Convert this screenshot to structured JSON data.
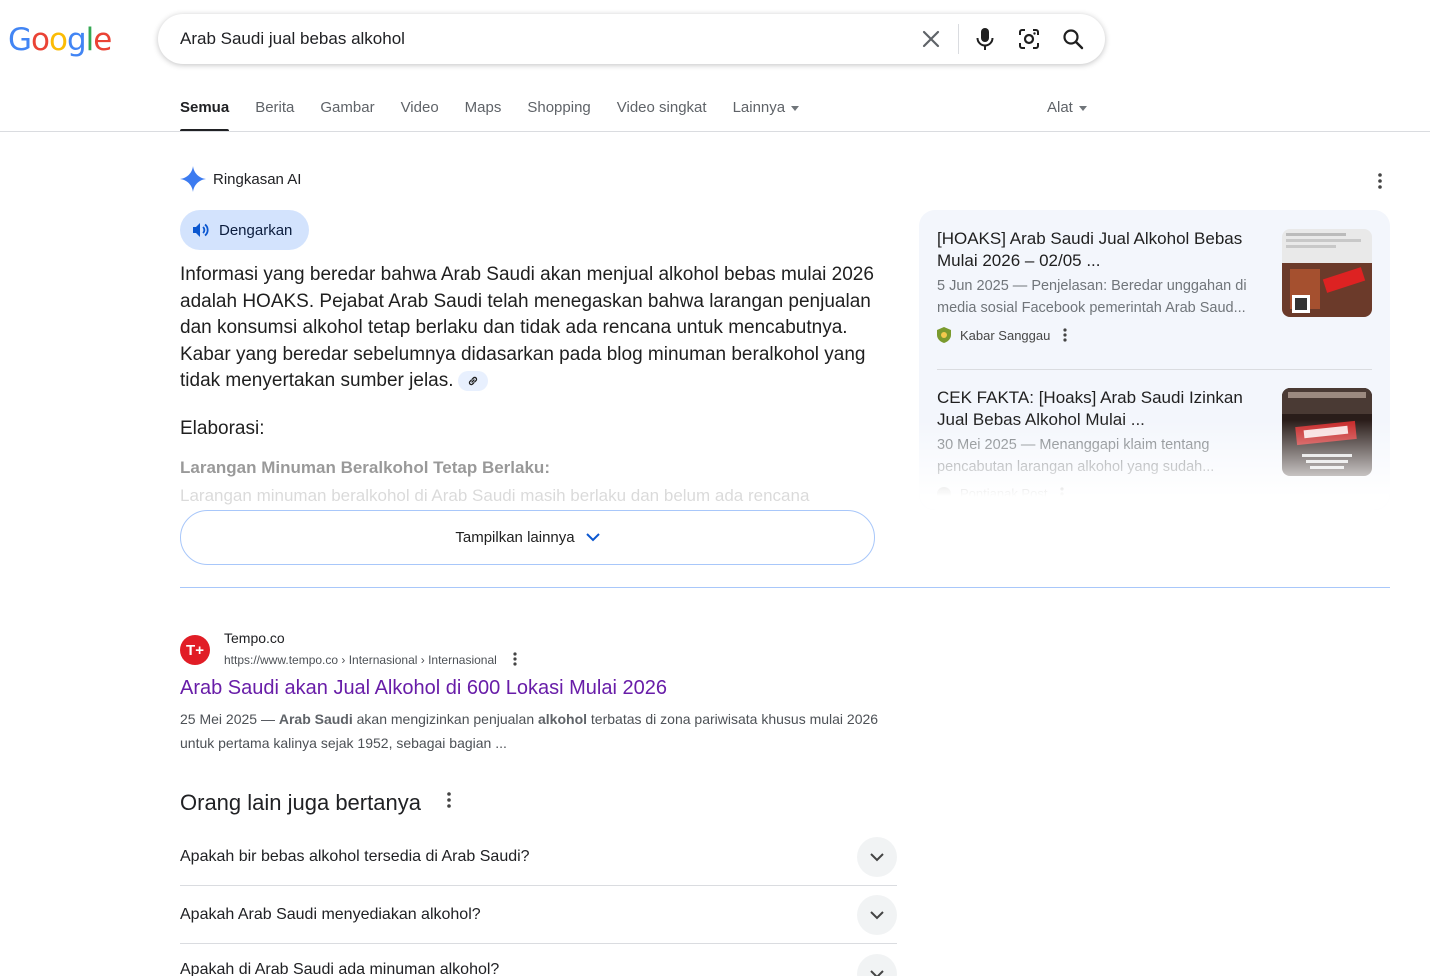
{
  "search": {
    "query": "Arab Saudi jual bebas alkohol"
  },
  "tabs": [
    {
      "label": "Semua"
    },
    {
      "label": "Berita"
    },
    {
      "label": "Gambar"
    },
    {
      "label": "Video"
    },
    {
      "label": "Maps"
    },
    {
      "label": "Shopping"
    },
    {
      "label": "Video singkat"
    },
    {
      "label": "Lainnya"
    }
  ],
  "tools_label": "Alat",
  "ai": {
    "title": "Ringkasan AI",
    "listen_label": "Dengarkan",
    "text": "Informasi yang beredar bahwa Arab Saudi akan menjual alkohol bebas mulai 2026 adalah HOAKS. Pejabat Arab Saudi telah menegaskan bahwa larangan penjualan dan konsumsi alkohol tetap berlaku dan tidak ada rencana untuk mencabutnya. Kabar yang beredar sebelumnya didasarkan pada blog minuman beralkohol yang tidak menyertakan sumber jelas.",
    "elab_title": "Elaborasi:",
    "elab_sub": "Larangan Minuman Beralkohol Tetap Berlaku:",
    "elab_body": "Larangan minuman beralkohol di Arab Saudi masih berlaku dan belum ada rencana",
    "show_more": "Tampilkan lainnya",
    "cards": [
      {
        "title": "[HOAKS] Arab Saudi Jual Alkohol Bebas Mulai 2026 – 02/05 ...",
        "snippet": "5 Jun 2025 — Penjelasan: Beredar unggahan di media sosial Facebook pemerintah Arab Saud...",
        "source": "Kabar Sanggau"
      },
      {
        "title": "CEK FAKTA: [Hoaks] Arab Saudi Izinkan Jual Bebas Alkohol Mulai ...",
        "snippet": "30 Mei 2025 — Menanggapi klaim tentang pencabutan larangan alkohol yang sudah...",
        "source": "Pontianak Post"
      }
    ]
  },
  "result": {
    "favicon_text": "T+",
    "site": "Tempo.co",
    "url": "https://www.tempo.co › Internasional › Internasional",
    "title": "Arab Saudi akan Jual Alkohol di 600 Lokasi Mulai 2026",
    "snippet_date": "25 Mei 2025 — ",
    "snippet_b1": "Arab Saudi",
    "snippet_t1": " akan mengizinkan penjualan ",
    "snippet_b2": "alkohol",
    "snippet_t2": " terbatas di zona pariwisata khusus mulai 2026 untuk pertama kalinya sejak 1952, sebagai bagian ..."
  },
  "paa": {
    "title": "Orang lain juga bertanya",
    "questions": [
      "Apakah bir bebas alkohol tersedia di Arab Saudi?",
      "Apakah Arab Saudi menyediakan alkohol?",
      "Apakah di Arab Saudi ada minuman alkohol?"
    ]
  }
}
